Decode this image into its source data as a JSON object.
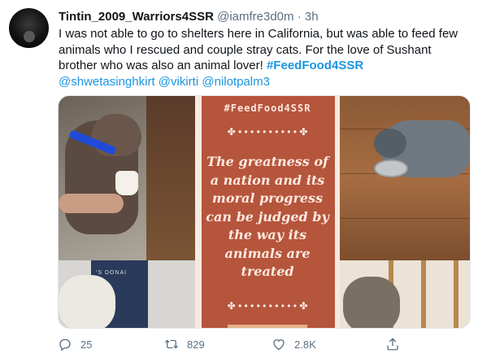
{
  "author": {
    "display_name": "Tintin_2009_Warriors4SSR",
    "handle": "@iamfre3d0m",
    "separator": "·",
    "time": "3h"
  },
  "tweet": {
    "text_plain": "I was not able to go to shelters here in California, but was able to feed few animals who I rescued and couple stray cats. For the love of Sushant brother who was also an animal lover!",
    "hashtag": "#FeedFood4SSR",
    "mentions": [
      "@shwetasinghkirt",
      "@vikirti",
      "@nilotpalm3"
    ]
  },
  "media": {
    "poster_tag": "#FeedFood4SSR",
    "divider": "✤ • • • • • • • • • • ✤",
    "poster_lines": [
      "The greatness of",
      "a nation and its",
      "moral progress",
      "can be judged by",
      "the way its",
      "animals are",
      "treated"
    ],
    "bag_text": "'S DONAI"
  },
  "actions": {
    "reply_count": "25",
    "retweet_count": "829",
    "like_count": "2.8K",
    "reply_icon": "reply-icon",
    "retweet_icon": "retweet-icon",
    "like_icon": "like-icon",
    "share_icon": "share-icon"
  },
  "colors": {
    "link": "#1b95e0",
    "secondary_text": "#5b7083",
    "poster_bg": "#b5553c"
  }
}
